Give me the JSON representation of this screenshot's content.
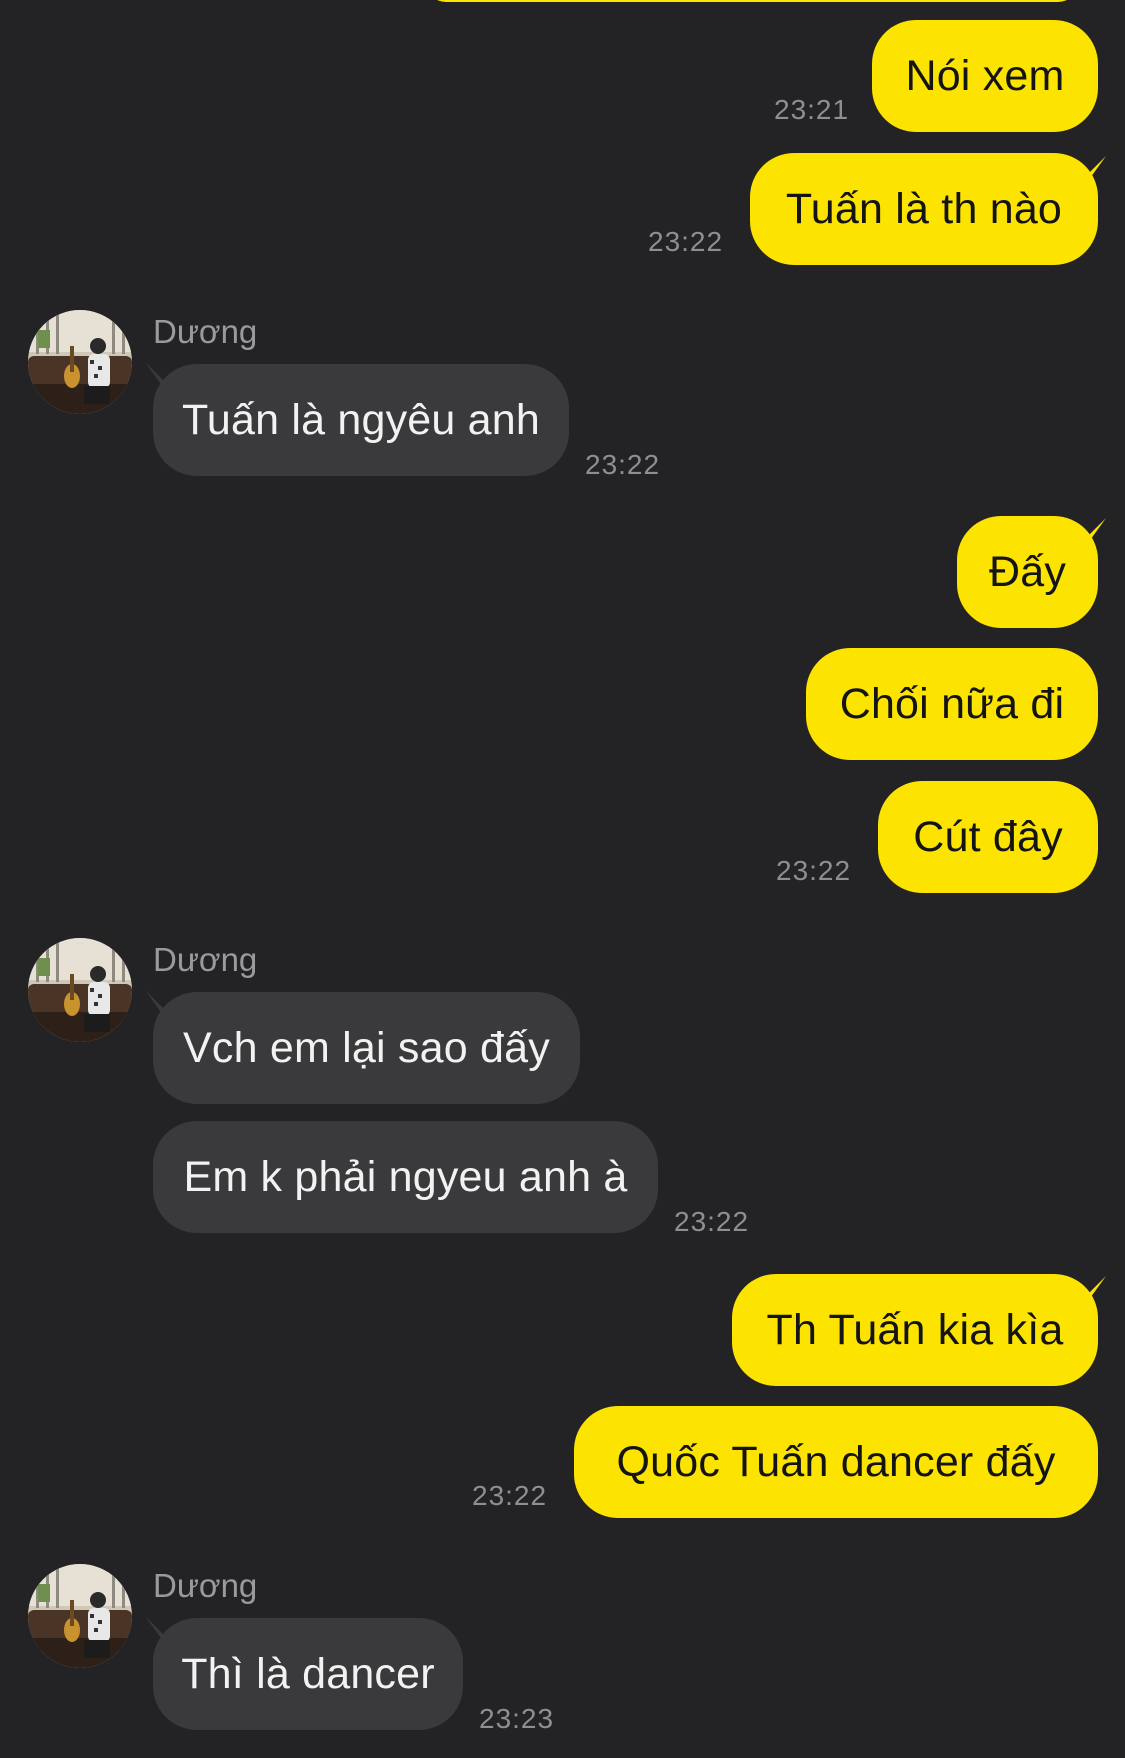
{
  "contact": {
    "name": "Dương"
  },
  "colors": {
    "background": "#232325",
    "outgoing_bubble": "#fce300",
    "incoming_bubble": "#3a3a3c"
  },
  "messages": [
    {
      "direction": "out",
      "text": "Nói xem",
      "time": "23:21"
    },
    {
      "direction": "out",
      "text": "Tuấn là th nào",
      "time": "23:22"
    },
    {
      "direction": "in",
      "text": "Tuấn là ngyêu anh",
      "time": "23:22"
    },
    {
      "direction": "out",
      "text": "Đấy"
    },
    {
      "direction": "out",
      "text": "Chối nữa đi"
    },
    {
      "direction": "out",
      "text": "Cút đây",
      "time": "23:22"
    },
    {
      "direction": "in",
      "text": "Vch em lại sao đấy"
    },
    {
      "direction": "in",
      "text": "Em k phải ngyeu anh à",
      "time": "23:22"
    },
    {
      "direction": "out",
      "text": "Th Tuấn kia kìa"
    },
    {
      "direction": "out",
      "text": "Quốc Tuấn dancer đấy",
      "time": "23:22"
    },
    {
      "direction": "in",
      "text": "Thì là dancer",
      "time": "23:23"
    }
  ]
}
